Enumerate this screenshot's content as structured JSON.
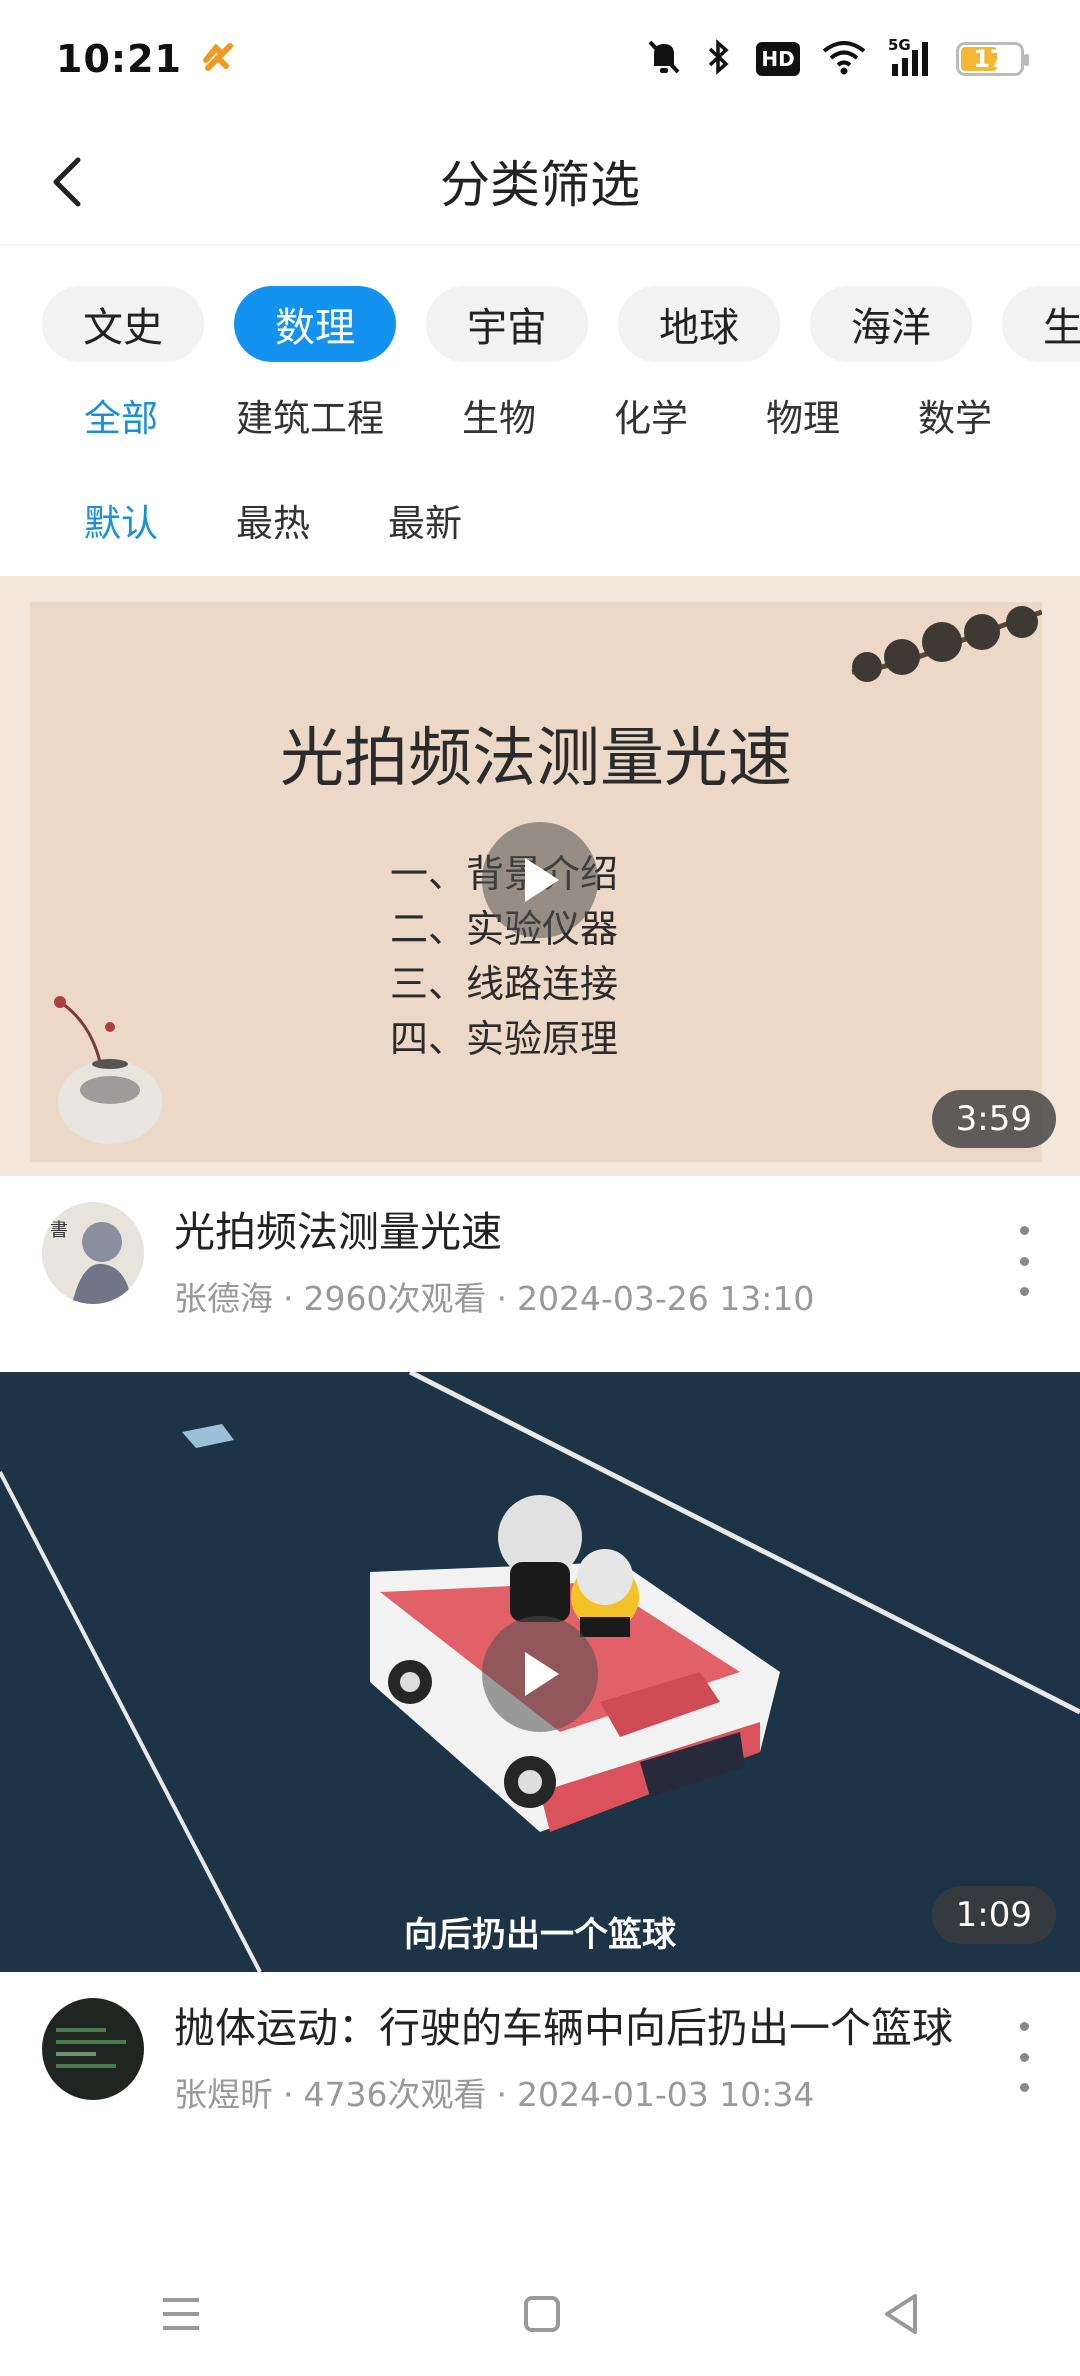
{
  "status_bar": {
    "time": "10:21",
    "battery": "17",
    "network": "5G",
    "hd_label": "HD"
  },
  "header": {
    "title": "分类筛选"
  },
  "categories": [
    {
      "label": "文史",
      "active": false
    },
    {
      "label": "数理",
      "active": true
    },
    {
      "label": "宇宙",
      "active": false
    },
    {
      "label": "地球",
      "active": false
    },
    {
      "label": "海洋",
      "active": false
    },
    {
      "label": "生命",
      "active": false
    }
  ],
  "subcategories": [
    {
      "label": "全部",
      "active": true
    },
    {
      "label": "建筑工程",
      "active": false
    },
    {
      "label": "生物",
      "active": false
    },
    {
      "label": "化学",
      "active": false
    },
    {
      "label": "物理",
      "active": false
    },
    {
      "label": "数学",
      "active": false
    }
  ],
  "sort_options": [
    {
      "label": "默认",
      "active": true
    },
    {
      "label": "最热",
      "active": false
    },
    {
      "label": "最新",
      "active": false
    }
  ],
  "videos": [
    {
      "thumbnail_title": "光拍频法测量光速",
      "thumbnail_outline": [
        "一、背景介绍",
        "二、实验仪器",
        "三、线路连接",
        "四、实验原理"
      ],
      "duration": "3:59",
      "title": "光拍频法测量光速",
      "author": "张德海",
      "views": "2960次观看",
      "date": "2024-03-26 13:10"
    },
    {
      "thumbnail_caption": "向后扔出一个篮球",
      "duration": "1:09",
      "title": "抛体运动：行驶的车辆中向后扔出一个篮球",
      "author": "张煜昕",
      "views": "4736次观看",
      "date": "2024-01-03 10:34"
    }
  ],
  "colors": {
    "accent": "#1492f0",
    "active_text": "#1a8fe0"
  }
}
